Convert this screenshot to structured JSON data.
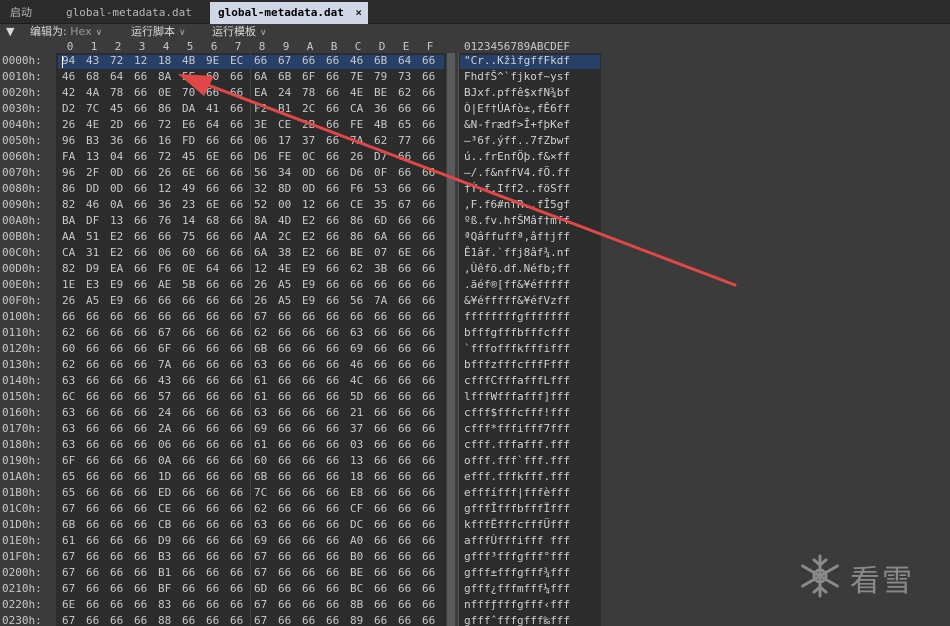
{
  "tabs": {
    "home": "启动",
    "file_inactive": "global-metadata.dat",
    "file_active": "global-metadata.dat",
    "close_glyph": "×"
  },
  "toolbar": {
    "collapse_glyph": "▼",
    "edit_as_label": "编辑为:",
    "edit_as_value": "Hex",
    "run_script": "运行脚本",
    "run_template": "运行模板"
  },
  "columns": [
    "0",
    "1",
    "2",
    "3",
    "4",
    "5",
    "6",
    "7",
    "8",
    "9",
    "A",
    "B",
    "C",
    "D",
    "E",
    "F"
  ],
  "ascii_header": "0123456789ABCDEF",
  "rows": [
    {
      "addr": "0000h:",
      "hex": [
        "94",
        "43",
        "72",
        "12",
        "18",
        "4B",
        "9E",
        "EC",
        "66",
        "67",
        "66",
        "66",
        "46",
        "6B",
        "64",
        "66"
      ],
      "ascii": "\"Cr..KžìfgffFkdf"
    },
    {
      "addr": "0010h:",
      "hex": [
        "46",
        "68",
        "64",
        "66",
        "8A",
        "5E",
        "60",
        "66",
        "6A",
        "6B",
        "6F",
        "66",
        "7E",
        "79",
        "73",
        "66"
      ],
      "ascii": "FhdfŠ^`fjkof~ysf"
    },
    {
      "addr": "0020h:",
      "hex": [
        "42",
        "4A",
        "78",
        "66",
        "0E",
        "70",
        "66",
        "66",
        "EA",
        "24",
        "78",
        "66",
        "4E",
        "BE",
        "62",
        "66"
      ],
      "ascii": "BJxf.pffê$xfN¾bf"
    },
    {
      "addr": "0030h:",
      "hex": [
        "D2",
        "7C",
        "45",
        "66",
        "86",
        "DA",
        "41",
        "66",
        "F2",
        "B1",
        "2C",
        "66",
        "CA",
        "36",
        "66",
        "66"
      ],
      "ascii": "Ò|Ef†ÚAfò±,fÊ6ff"
    },
    {
      "addr": "0040h:",
      "hex": [
        "26",
        "4E",
        "2D",
        "66",
        "72",
        "E6",
        "64",
        "66",
        "3E",
        "CE",
        "2B",
        "66",
        "FE",
        "4B",
        "65",
        "66"
      ],
      "ascii": "&N-frædf>Î+fþKef"
    },
    {
      "addr": "0050h:",
      "hex": [
        "96",
        "B3",
        "36",
        "66",
        "16",
        "FD",
        "66",
        "66",
        "06",
        "17",
        "37",
        "66",
        "7A",
        "62",
        "77",
        "66"
      ],
      "ascii": "–³6f.ýff..7fZbwf"
    },
    {
      "addr": "0060h:",
      "hex": [
        "FA",
        "13",
        "04",
        "66",
        "72",
        "45",
        "6E",
        "66",
        "D6",
        "FE",
        "0C",
        "66",
        "26",
        "D7",
        "66",
        "66"
      ],
      "ascii": "ú..frEnfÖþ.f&×ff"
    },
    {
      "addr": "0070h:",
      "hex": [
        "96",
        "2F",
        "0D",
        "66",
        "26",
        "6E",
        "66",
        "66",
        "56",
        "34",
        "0D",
        "66",
        "D6",
        "0F",
        "66",
        "66"
      ],
      "ascii": "–/.f&nffV4.fÖ.ff"
    },
    {
      "addr": "0080h:",
      "hex": [
        "86",
        "DD",
        "0D",
        "66",
        "12",
        "49",
        "66",
        "66",
        "32",
        "8D",
        "0D",
        "66",
        "F6",
        "53",
        "66",
        "66"
      ],
      "ascii": "†Ý.f.Iff2..föSff"
    },
    {
      "addr": "0090h:",
      "hex": [
        "82",
        "46",
        "0A",
        "66",
        "36",
        "23",
        "6E",
        "66",
        "52",
        "00",
        "12",
        "66",
        "CE",
        "35",
        "67",
        "66"
      ],
      "ascii": ",F.f6#nfR..fÎ5gf"
    },
    {
      "addr": "00A0h:",
      "hex": [
        "BA",
        "DF",
        "13",
        "66",
        "76",
        "14",
        "68",
        "66",
        "8A",
        "4D",
        "E2",
        "66",
        "86",
        "6D",
        "66",
        "66"
      ],
      "ascii": "ºß.fv.hfŠMâf†mff"
    },
    {
      "addr": "00B0h:",
      "hex": [
        "AA",
        "51",
        "E2",
        "66",
        "66",
        "75",
        "66",
        "66",
        "AA",
        "2C",
        "E2",
        "66",
        "86",
        "6A",
        "66",
        "66"
      ],
      "ascii": "ªQâffuffª,âf†jff"
    },
    {
      "addr": "00C0h:",
      "hex": [
        "CA",
        "31",
        "E2",
        "66",
        "06",
        "60",
        "66",
        "66",
        "6A",
        "38",
        "E2",
        "66",
        "BE",
        "07",
        "6E",
        "66"
      ],
      "ascii": "Ê1âf.`ffj8âf¾.nf"
    },
    {
      "addr": "00D0h:",
      "hex": [
        "82",
        "D9",
        "EA",
        "66",
        "F6",
        "0E",
        "64",
        "66",
        "12",
        "4E",
        "E9",
        "66",
        "62",
        "3B",
        "66",
        "66"
      ],
      "ascii": ",Ùêfö.df.Néfb;ff"
    },
    {
      "addr": "00E0h:",
      "hex": [
        "1E",
        "E3",
        "E9",
        "66",
        "AE",
        "5B",
        "66",
        "66",
        "26",
        "A5",
        "E9",
        "66",
        "66",
        "66",
        "66",
        "66"
      ],
      "ascii": ".ãéf®[ff&¥éfffff"
    },
    {
      "addr": "00F0h:",
      "hex": [
        "26",
        "A5",
        "E9",
        "66",
        "66",
        "66",
        "66",
        "66",
        "26",
        "A5",
        "E9",
        "66",
        "56",
        "7A",
        "66",
        "66"
      ],
      "ascii": "&¥éfffff&¥éfVzff"
    },
    {
      "addr": "0100h:",
      "hex": [
        "66",
        "66",
        "66",
        "66",
        "66",
        "66",
        "66",
        "66",
        "67",
        "66",
        "66",
        "66",
        "66",
        "66",
        "66",
        "66"
      ],
      "ascii": "ffffffffgfffffff"
    },
    {
      "addr": "0110h:",
      "hex": [
        "62",
        "66",
        "66",
        "66",
        "67",
        "66",
        "66",
        "66",
        "62",
        "66",
        "66",
        "66",
        "63",
        "66",
        "66",
        "66"
      ],
      "ascii": "bfffgfffbfffcfff"
    },
    {
      "addr": "0120h:",
      "hex": [
        "60",
        "66",
        "66",
        "66",
        "6F",
        "66",
        "66",
        "66",
        "6B",
        "66",
        "66",
        "66",
        "69",
        "66",
        "66",
        "66"
      ],
      "ascii": "`fffofffkfffifff"
    },
    {
      "addr": "0130h:",
      "hex": [
        "62",
        "66",
        "66",
        "66",
        "7A",
        "66",
        "66",
        "66",
        "63",
        "66",
        "66",
        "66",
        "46",
        "66",
        "66",
        "66"
      ],
      "ascii": "bfffzfffcfffFfff"
    },
    {
      "addr": "0140h:",
      "hex": [
        "63",
        "66",
        "66",
        "66",
        "43",
        "66",
        "66",
        "66",
        "61",
        "66",
        "66",
        "66",
        "4C",
        "66",
        "66",
        "66"
      ],
      "ascii": "cfffCfffafffLfff"
    },
    {
      "addr": "0150h:",
      "hex": [
        "6C",
        "66",
        "66",
        "66",
        "57",
        "66",
        "66",
        "66",
        "61",
        "66",
        "66",
        "66",
        "5D",
        "66",
        "66",
        "66"
      ],
      "ascii": "lfffWfffafff]fff"
    },
    {
      "addr": "0160h:",
      "hex": [
        "63",
        "66",
        "66",
        "66",
        "24",
        "66",
        "66",
        "66",
        "63",
        "66",
        "66",
        "66",
        "21",
        "66",
        "66",
        "66"
      ],
      "ascii": "cfff$fffcfff!fff"
    },
    {
      "addr": "0170h:",
      "hex": [
        "63",
        "66",
        "66",
        "66",
        "2A",
        "66",
        "66",
        "66",
        "69",
        "66",
        "66",
        "66",
        "37",
        "66",
        "66",
        "66"
      ],
      "ascii": "cfff*fffifff7fff"
    },
    {
      "addr": "0180h:",
      "hex": [
        "63",
        "66",
        "66",
        "66",
        "06",
        "66",
        "66",
        "66",
        "61",
        "66",
        "66",
        "66",
        "03",
        "66",
        "66",
        "66"
      ],
      "ascii": "cfff.fffafff.fff"
    },
    {
      "addr": "0190h:",
      "hex": [
        "6F",
        "66",
        "66",
        "66",
        "0A",
        "66",
        "66",
        "66",
        "60",
        "66",
        "66",
        "66",
        "13",
        "66",
        "66",
        "66"
      ],
      "ascii": "offf.fff`fff.fff"
    },
    {
      "addr": "01A0h:",
      "hex": [
        "65",
        "66",
        "66",
        "66",
        "1D",
        "66",
        "66",
        "66",
        "6B",
        "66",
        "66",
        "66",
        "18",
        "66",
        "66",
        "66"
      ],
      "ascii": "efff.fffkfff.fff"
    },
    {
      "addr": "01B0h:",
      "hex": [
        "65",
        "66",
        "66",
        "66",
        "ED",
        "66",
        "66",
        "66",
        "7C",
        "66",
        "66",
        "66",
        "E8",
        "66",
        "66",
        "66"
      ],
      "ascii": "efffífff|fffèfff"
    },
    {
      "addr": "01C0h:",
      "hex": [
        "67",
        "66",
        "66",
        "66",
        "CE",
        "66",
        "66",
        "66",
        "62",
        "66",
        "66",
        "66",
        "CF",
        "66",
        "66",
        "66"
      ],
      "ascii": "gfffÎfffbfffÏfff"
    },
    {
      "addr": "01D0h:",
      "hex": [
        "6B",
        "66",
        "66",
        "66",
        "CB",
        "66",
        "66",
        "66",
        "63",
        "66",
        "66",
        "66",
        "DC",
        "66",
        "66",
        "66"
      ],
      "ascii": "kfffËfffcfffÜfff"
    },
    {
      "addr": "01E0h:",
      "hex": [
        "61",
        "66",
        "66",
        "66",
        "D9",
        "66",
        "66",
        "66",
        "69",
        "66",
        "66",
        "66",
        "A0",
        "66",
        "66",
        "66"
      ],
      "ascii": "afffÙfffifff fff"
    },
    {
      "addr": "01F0h:",
      "hex": [
        "67",
        "66",
        "66",
        "66",
        "B3",
        "66",
        "66",
        "66",
        "67",
        "66",
        "66",
        "66",
        "B0",
        "66",
        "66",
        "66"
      ],
      "ascii": "gfff³fffgfff°fff"
    },
    {
      "addr": "0200h:",
      "hex": [
        "67",
        "66",
        "66",
        "66",
        "B1",
        "66",
        "66",
        "66",
        "67",
        "66",
        "66",
        "66",
        "BE",
        "66",
        "66",
        "66"
      ],
      "ascii": "gfff±fffgfff¾fff"
    },
    {
      "addr": "0210h:",
      "hex": [
        "67",
        "66",
        "66",
        "66",
        "BF",
        "66",
        "66",
        "66",
        "6D",
        "66",
        "66",
        "66",
        "BC",
        "66",
        "66",
        "66"
      ],
      "ascii": "gfff¿fffmfff¼fff"
    },
    {
      "addr": "0220h:",
      "hex": [
        "6E",
        "66",
        "66",
        "66",
        "83",
        "66",
        "66",
        "66",
        "67",
        "66",
        "66",
        "66",
        "8B",
        "66",
        "66",
        "66"
      ],
      "ascii": "nfffƒfffgfff‹fff"
    },
    {
      "addr": "0230h:",
      "hex": [
        "67",
        "66",
        "66",
        "66",
        "88",
        "66",
        "66",
        "66",
        "67",
        "66",
        "66",
        "66",
        "89",
        "66",
        "66",
        "66"
      ],
      "ascii": "gfffˆfffgfff‰fff"
    }
  ],
  "watermark": "看雪",
  "colors": {
    "arrow": "#e04848",
    "selection": "#27406a",
    "active_tab": "#d0d8e8"
  }
}
